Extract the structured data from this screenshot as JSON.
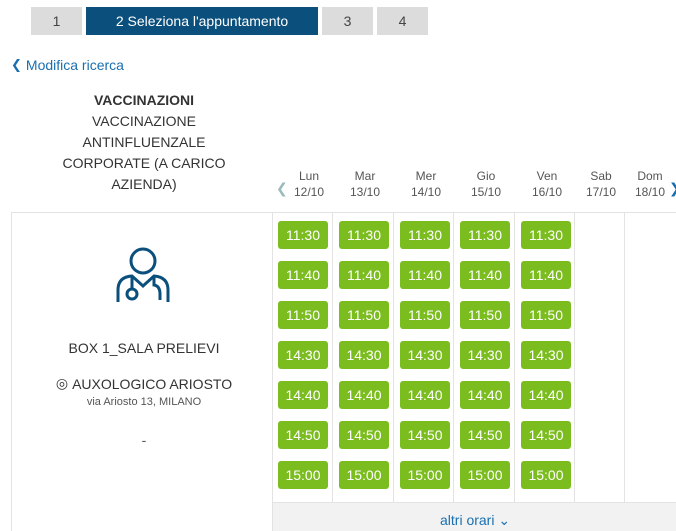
{
  "steps": [
    {
      "label": "1"
    },
    {
      "label": "2  Seleziona l'appuntamento"
    },
    {
      "label": "3"
    },
    {
      "label": "4"
    }
  ],
  "back_link": {
    "label": "Modifica ricerca"
  },
  "service": {
    "category": "VACCINAZIONI",
    "name_lines": [
      "VACCINAZIONE",
      "ANTINFLUENZALE",
      "CORPORATE (A CARICO",
      "AZIENDA)"
    ]
  },
  "days": [
    {
      "name": "Lun",
      "date": "12/10"
    },
    {
      "name": "Mar",
      "date": "13/10"
    },
    {
      "name": "Mer",
      "date": "14/10"
    },
    {
      "name": "Gio",
      "date": "15/10"
    },
    {
      "name": "Ven",
      "date": "16/10"
    },
    {
      "name": "Sab",
      "date": "17/10"
    },
    {
      "name": "Dom",
      "date": "18/10"
    }
  ],
  "times": [
    "11:30",
    "11:40",
    "11:50",
    "14:30",
    "14:40",
    "14:50",
    "15:00"
  ],
  "provider": {
    "room": "BOX 1_SALA PRELIEVI",
    "location": "AUXOLOGICO ARIOSTO",
    "address": "via Ariosto 13, MILANO",
    "extra": "-"
  },
  "more_times": {
    "label": "altri orari"
  },
  "colors": {
    "primary": "#0b4f7c",
    "slot": "#7bbd1f",
    "link": "#1a6fb0"
  }
}
